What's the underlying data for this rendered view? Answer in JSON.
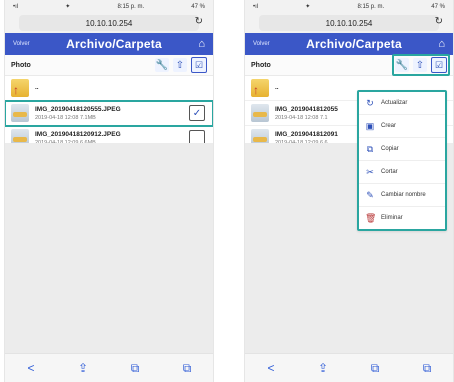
{
  "left": {
    "status": {
      "carrier": "•ıl",
      "wifi": "✦",
      "time": "8:15 p. m.",
      "battery": "47 %"
    },
    "url": "10.10.10.254",
    "nav": {
      "back_label": "Volver",
      "title": "Archivo/Carpeta",
      "home_icon": "home-icon"
    },
    "toolbar": {
      "label": "Photo"
    },
    "list": {
      "items": [
        {
          "name": "..",
          "sub": ""
        },
        {
          "name": "IMG_20190418120555.JPEG",
          "sub": "2019-04-18 12:08   7.1MB",
          "checked": "✓"
        },
        {
          "name": "IMG_20190418120912.JPEG",
          "sub": "2019-04-18 12:09   6.6MB",
          "checked": ""
        }
      ]
    },
    "bottom": {
      "tabs": [
        "<",
        "⇪",
        "⧉",
        "⧉"
      ]
    }
  },
  "right": {
    "status": {
      "carrier": "•ıl",
      "wifi": "✦",
      "time": "8:15 p. m.",
      "battery": "47 %"
    },
    "url": "10.10.10.254",
    "nav": {
      "back_label": "Volver",
      "title": "Archivo/Carpeta",
      "home_icon": "home-icon"
    },
    "toolbar": {
      "label": "Photo"
    },
    "list": {
      "items": [
        {
          "name": "..",
          "sub": ""
        },
        {
          "name": "IMG_2019041812055",
          "sub": "2019-04-18 12:08   7.1"
        },
        {
          "name": "IMG_2019041812091",
          "sub": "2019-04-18 12:09   6.6"
        }
      ]
    },
    "menu": {
      "items": [
        "Actualizar",
        "Crear",
        "Copiar",
        "Cortar",
        "Cambiar nombre",
        "Eliminar"
      ]
    },
    "bottom": {
      "tabs": [
        "<",
        "⇪",
        "⧉",
        "⧉"
      ]
    }
  },
  "colors": {
    "accent": "#3b57c7",
    "highlight": "#2aa6a0"
  }
}
